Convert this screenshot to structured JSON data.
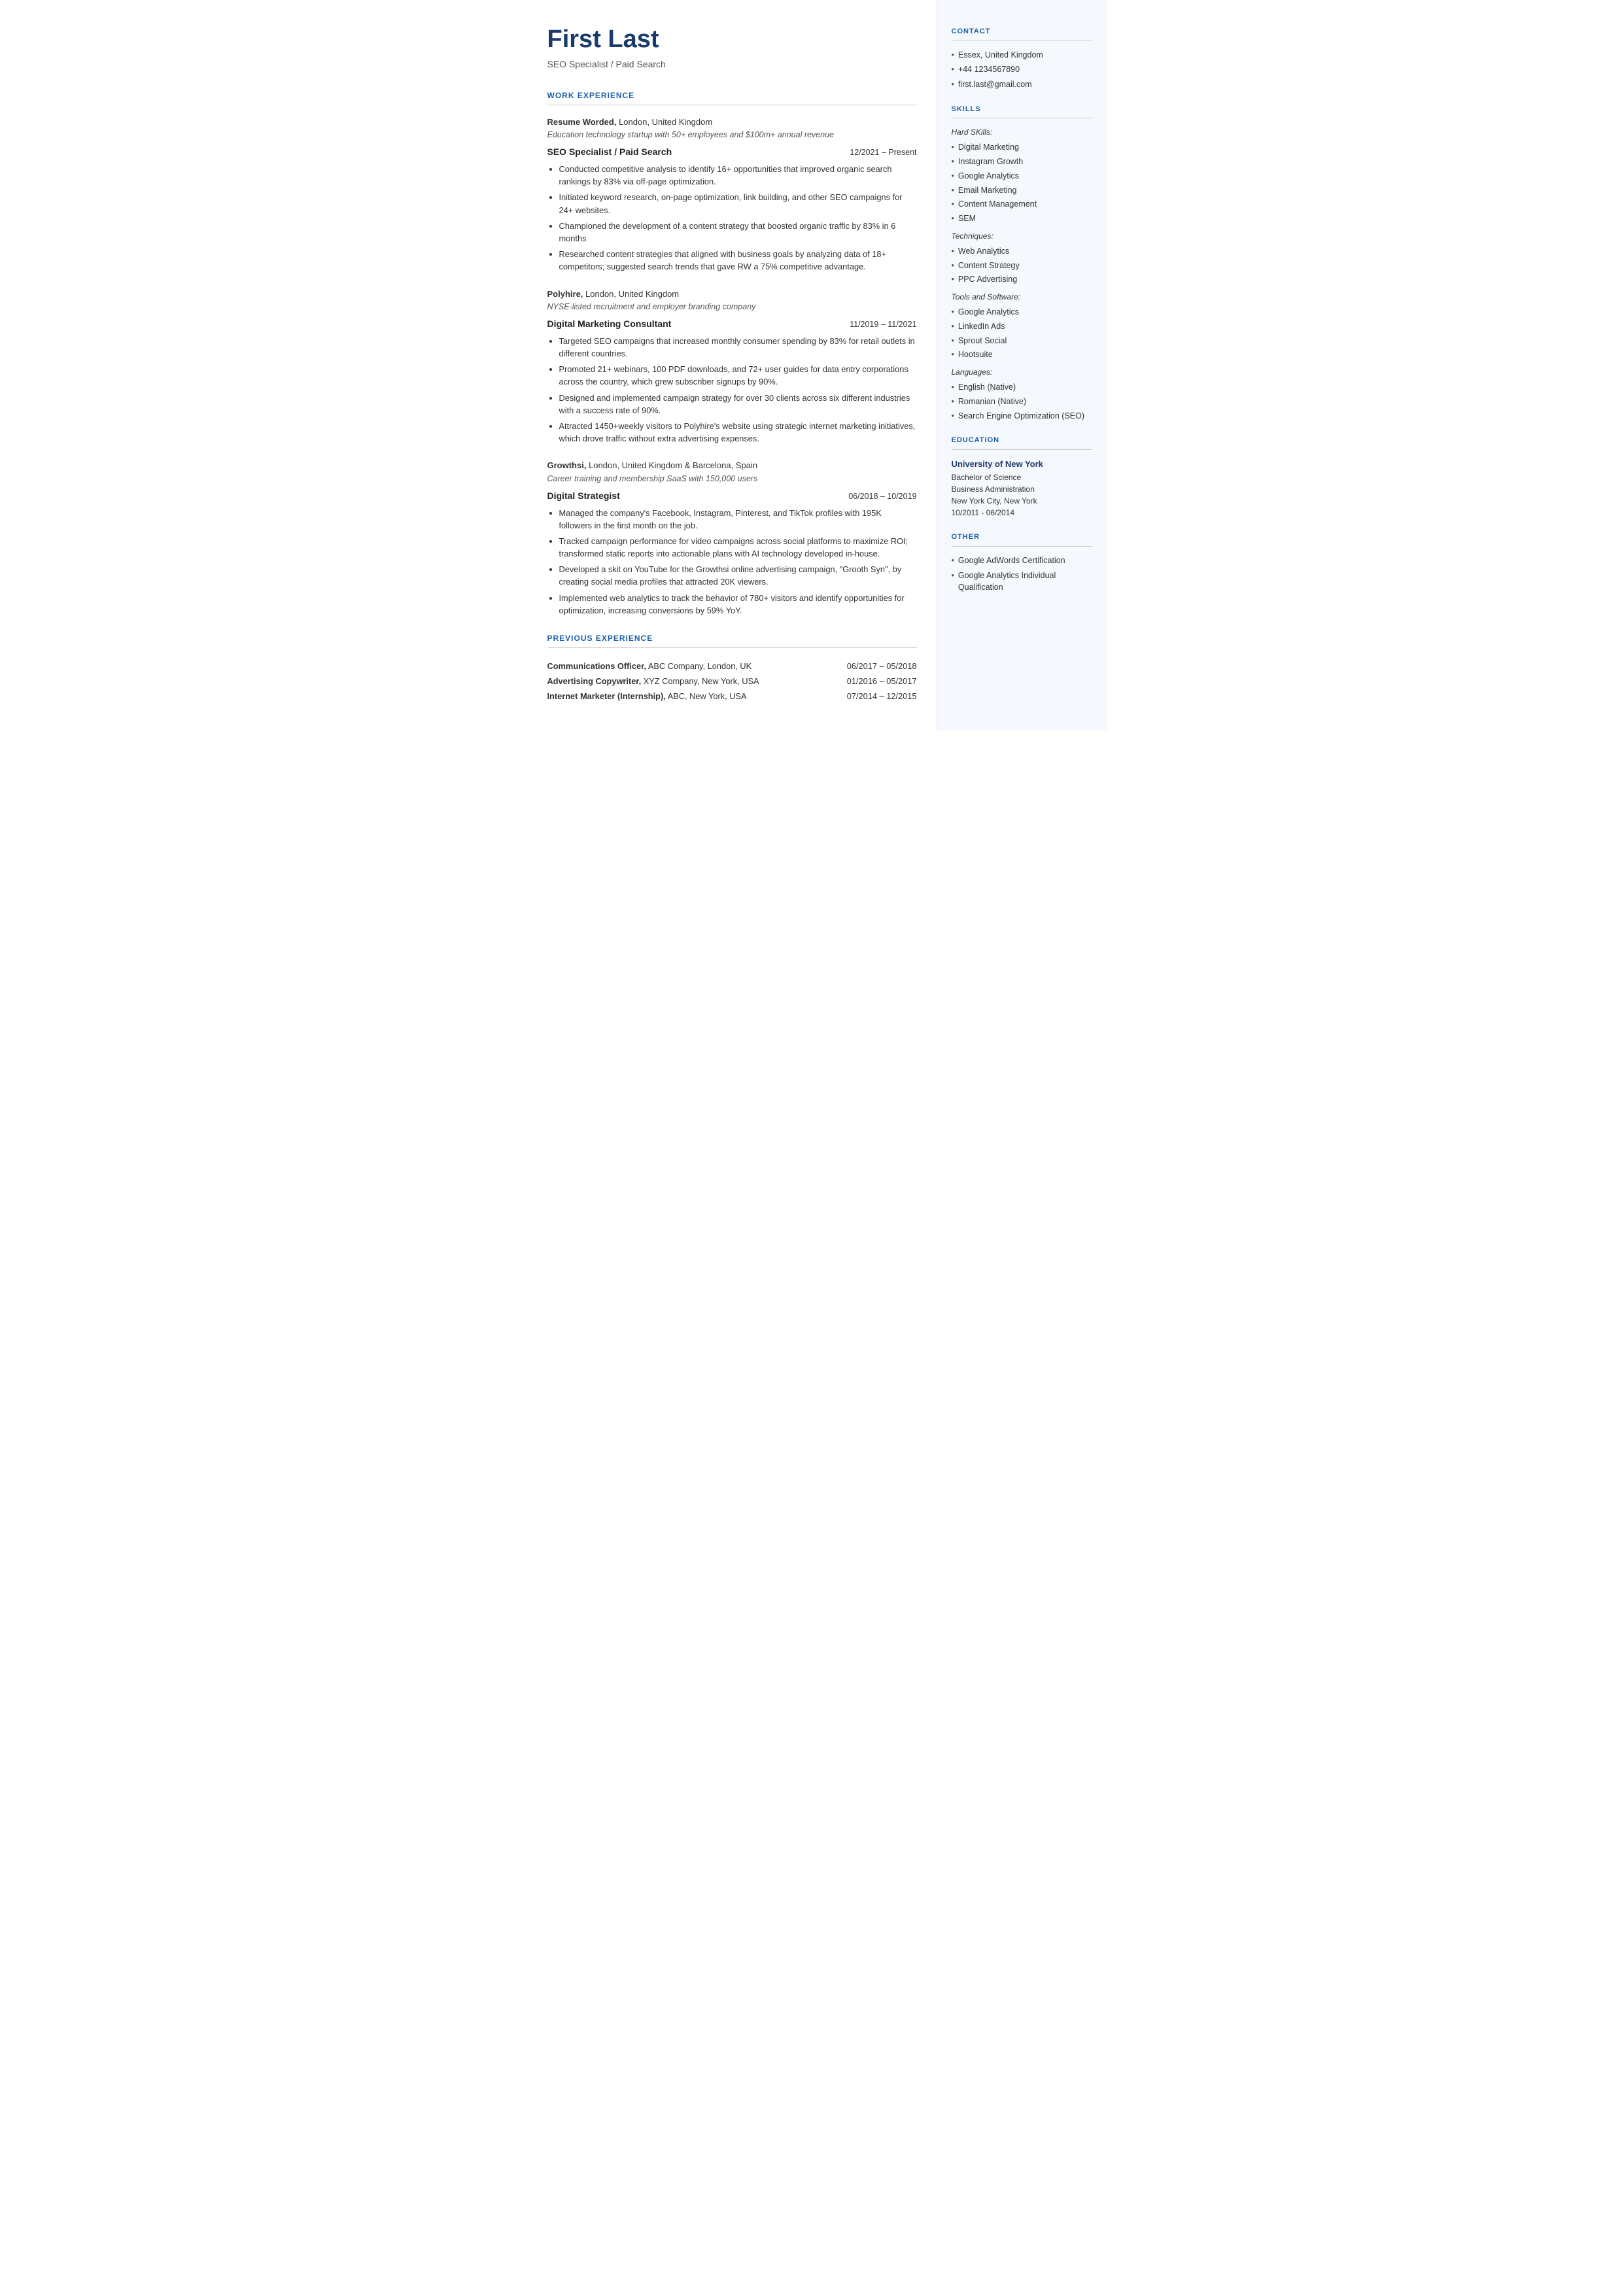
{
  "header": {
    "name": "First Last",
    "subtitle": "SEO Specialist / Paid Search"
  },
  "left": {
    "work_experience_title": "WORK EXPERIENCE",
    "jobs": [
      {
        "company": "Resume Worded,",
        "company_rest": " London, United Kingdom",
        "company_desc": "Education technology startup with 50+ employees and $100m+ annual revenue",
        "title": "SEO Specialist / Paid Search",
        "dates": "12/2021 – Present",
        "bullets": [
          "Conducted competitive analysis to identify 16+ opportunities that improved organic search rankings by 83% via off-page optimization.",
          "Initiated keyword research, on-page optimization, link building, and other SEO campaigns for 24+ websites.",
          "Championed the development of a content strategy that boosted organic traffic by 83% in 6 months",
          "Researched content strategies that aligned with business goals by analyzing data of 18+ competitors; suggested search trends that gave RW a 75% competitive advantage."
        ]
      },
      {
        "company": "Polyhire,",
        "company_rest": " London, United Kingdom",
        "company_desc": "NYSE-listed recruitment and employer branding company",
        "title": "Digital Marketing Consultant",
        "dates": "11/2019 – 11/2021",
        "bullets": [
          "Targeted SEO campaigns that increased monthly consumer spending by 83% for retail outlets in different countries.",
          "Promoted 21+ webinars, 100 PDF downloads, and 72+ user guides for data entry corporations across the country, which grew subscriber signups by 90%.",
          "Designed and implemented campaign strategy for over 30 clients across six different industries with a success rate of 90%.",
          "Attracted 1450+weekly visitors to Polyhire's website using strategic internet marketing initiatives, which drove traffic without extra advertising expenses."
        ]
      },
      {
        "company": "Growthsi,",
        "company_rest": " London, United Kingdom & Barcelona, Spain",
        "company_desc": "Career training and membership SaaS with 150,000 users",
        "title": "Digital Strategist",
        "dates": "06/2018 – 10/2019",
        "bullets": [
          "Managed the company's Facebook, Instagram, Pinterest, and TikTok profiles with 195K followers in the first month on the job.",
          "Tracked campaign performance for video campaigns across social platforms to maximize ROI; transformed static reports into actionable plans with AI technology developed in-house.",
          "Developed a skit on YouTube for the Growthsi online advertising campaign, \"Grooth Syn\", by creating social media profiles that attracted 20K viewers.",
          "Implemented web analytics to track the behavior of 780+ visitors and identify opportunities for optimization, increasing conversions by 59% YoY."
        ]
      }
    ],
    "previous_experience_title": "PREVIOUS EXPERIENCE",
    "previous_jobs": [
      {
        "title_bold": "Communications Officer,",
        "title_rest": " ABC Company, London, UK",
        "dates": "06/2017 – 05/2018"
      },
      {
        "title_bold": "Advertising Copywriter,",
        "title_rest": " XYZ Company, New York, USA",
        "dates": "01/2016 – 05/2017"
      },
      {
        "title_bold": "Internet Marketer (Internship),",
        "title_rest": " ABC, New York, USA",
        "dates": "07/2014 – 12/2015"
      }
    ]
  },
  "right": {
    "contact_title": "CONTACT",
    "contact_items": [
      "Essex, United Kingdom",
      "+44 1234567890",
      "first.last@gmail.com"
    ],
    "skills_title": "SKILLS",
    "hard_skills_label": "Hard SKills:",
    "hard_skills": [
      "Digital Marketing",
      "Instagram Growth",
      "Google Analytics",
      "Email Marketing",
      "Content Management",
      "SEM"
    ],
    "techniques_label": "Techniques:",
    "techniques": [
      "Web Analytics",
      "Content Strategy",
      "PPC Advertising"
    ],
    "tools_label": "Tools and Software:",
    "tools": [
      "Google Analytics",
      "LinkedIn Ads",
      "Sprout Social",
      "Hootsuite"
    ],
    "languages_label": "Languages:",
    "languages": [
      "English (Native)",
      "Romanian (Native)",
      "Search Engine Optimization (SEO)"
    ],
    "education_title": "EDUCATION",
    "education": {
      "school": "University of New York",
      "degree": "Bachelor of Science",
      "field": "Business Administration",
      "location": "New York City, New York",
      "dates": "10/2011 - 06/2014"
    },
    "other_title": "OTHER",
    "other_items": [
      "Google AdWords Certification",
      "Google Analytics Individual Qualification"
    ]
  }
}
